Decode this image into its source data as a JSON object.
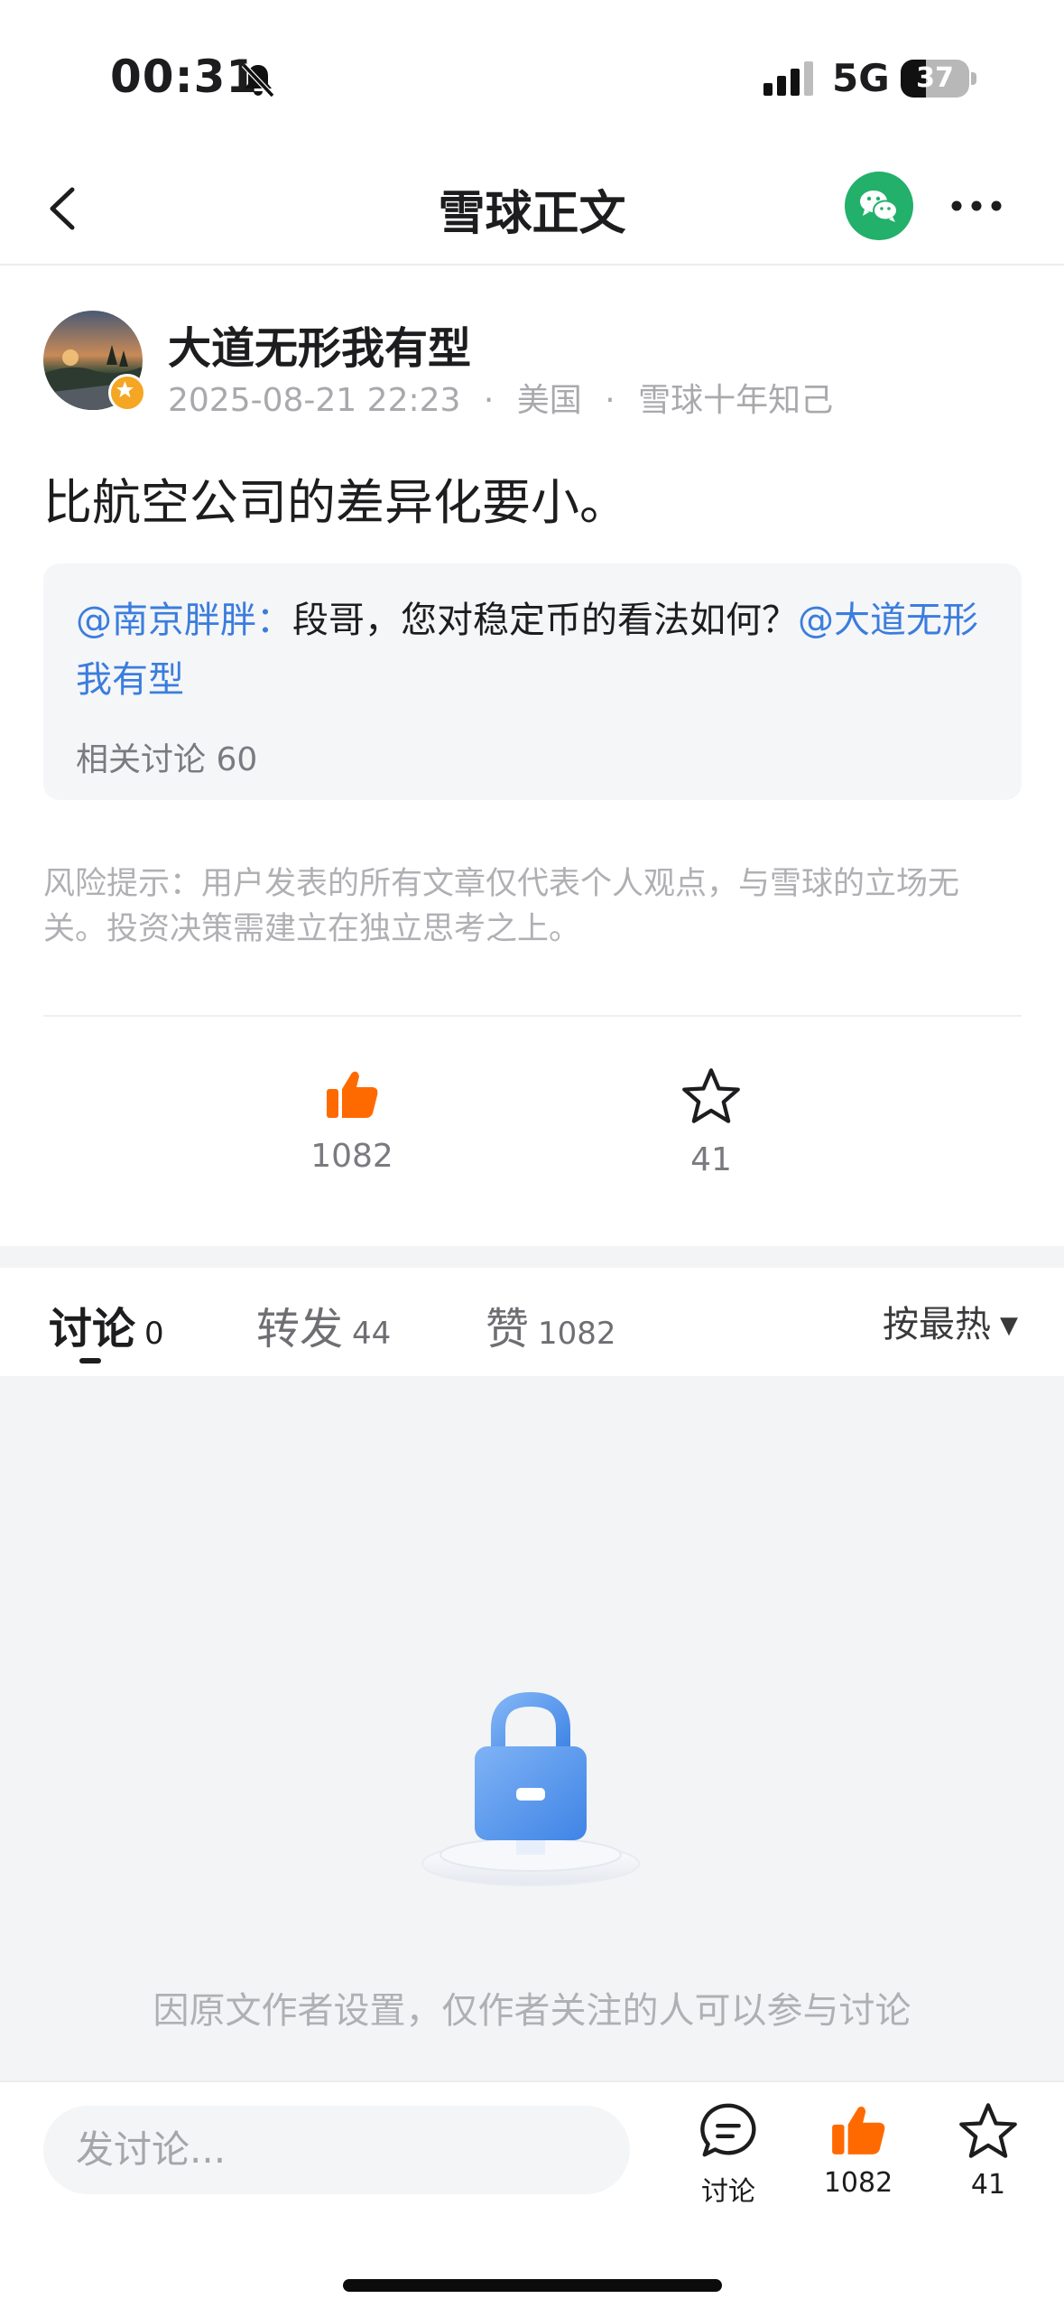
{
  "status_bar": {
    "time": "00:31",
    "network": "5G",
    "battery_percent": "37",
    "battery_level": 0.37
  },
  "nav": {
    "title": "雪球正文",
    "share_icon": "wechat-icon",
    "more_icon": "more-icon"
  },
  "post": {
    "author": "大道无形我有型",
    "datetime": "2025-08-21 22:23",
    "location": "美国",
    "badge_text": "雪球十年知己",
    "meta_sep": "·",
    "body": "比航空公司的差异化要小。",
    "quote": {
      "mention_user": "@南京胖胖：",
      "text": "段哥，您对稳定币的看法如何？",
      "mention_author": "@大道无形我有型",
      "related": "相关讨论 60"
    },
    "risk_note": "风险提示：用户发表的所有文章仅代表个人观点，与雪球的立场无关。投资决策需建立在独立思考之上。",
    "likes": "1082",
    "favorites": "41"
  },
  "tabs": {
    "items": [
      {
        "label": "讨论",
        "count": "0"
      },
      {
        "label": "转发",
        "count": "44"
      },
      {
        "label": "赞",
        "count": "1082"
      }
    ],
    "sort": "按最热"
  },
  "empty_state": {
    "message": "因原文作者设置，仅作者关注的人可以参与讨论"
  },
  "bottom_bar": {
    "input_placeholder": "发讨论...",
    "discuss_label": "讨论",
    "likes": "1082",
    "favorites": "41"
  },
  "colors": {
    "accent_orange": "#ff6a00",
    "mention_blue": "#3b7ddd",
    "wechat_green": "#22b06b"
  }
}
